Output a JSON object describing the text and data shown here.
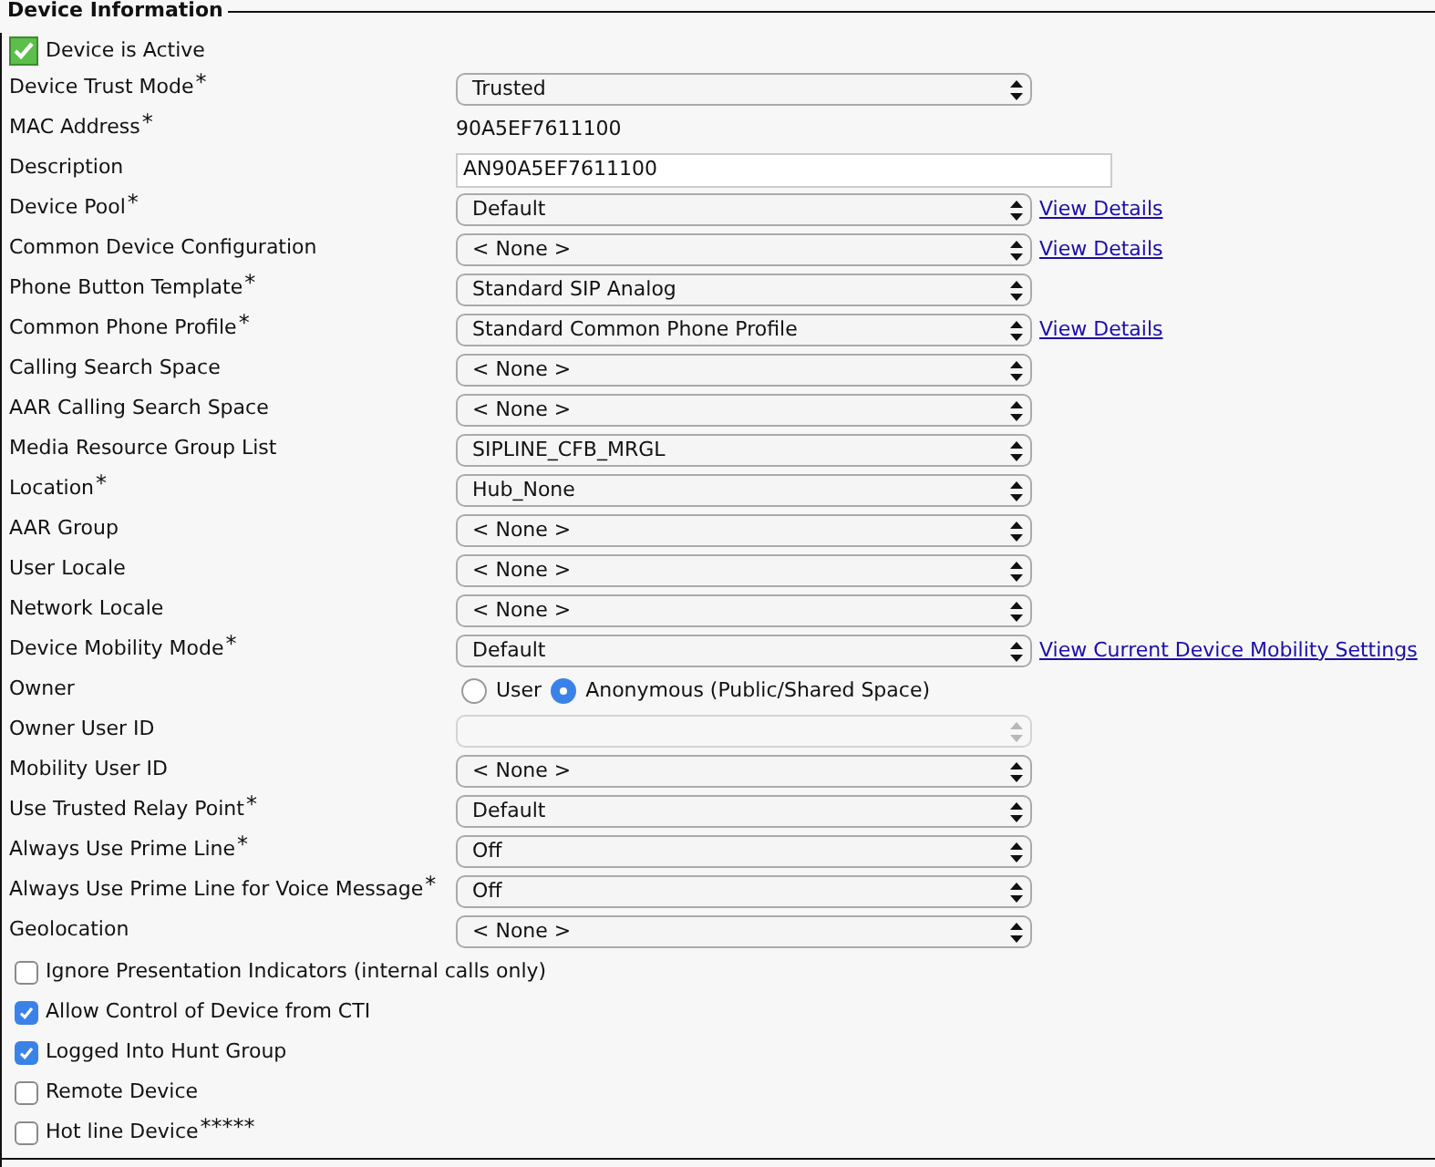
{
  "section": {
    "title": "Device Information"
  },
  "device_active": {
    "label": "Device is Active",
    "checked": true
  },
  "fields": [
    {
      "label": "Device Trust Mode",
      "mark": "*",
      "kind": "select",
      "value": "Trusted",
      "disabled": false
    },
    {
      "label": "MAC Address",
      "mark": "*",
      "kind": "text",
      "value": "90A5EF7611100"
    },
    {
      "label": "Description",
      "kind": "input",
      "value": "AN90A5EF7611100"
    },
    {
      "label": "Device Pool",
      "mark": "*",
      "kind": "select",
      "value": "Default",
      "disabled": false,
      "link": "View Details"
    },
    {
      "label": "Common Device Configuration",
      "kind": "select",
      "value": "< None >",
      "disabled": false,
      "link": "View Details"
    },
    {
      "label": "Phone Button Template",
      "mark": "*",
      "kind": "select",
      "value": "Standard SIP Analog",
      "disabled": false
    },
    {
      "label": "Common Phone Profile",
      "mark": "*",
      "kind": "select",
      "value": "Standard Common Phone Profile",
      "disabled": false,
      "link": "View Details"
    },
    {
      "label": "Calling Search Space",
      "kind": "select",
      "value": "< None >",
      "disabled": false
    },
    {
      "label": "AAR Calling Search Space",
      "kind": "select",
      "value": "< None >",
      "disabled": false
    },
    {
      "label": "Media Resource Group List",
      "kind": "select",
      "value": "SIPLINE_CFB_MRGL",
      "disabled": false
    },
    {
      "label": "Location",
      "mark": "*",
      "kind": "select",
      "value": "Hub_None",
      "disabled": false
    },
    {
      "label": "AAR Group",
      "kind": "select",
      "value": "< None >",
      "disabled": false
    },
    {
      "label": "User Locale",
      "kind": "select",
      "value": "< None >",
      "disabled": false
    },
    {
      "label": "Network Locale",
      "kind": "select",
      "value": "< None >",
      "disabled": false
    },
    {
      "label": "Device Mobility Mode",
      "mark": "*",
      "kind": "select",
      "value": "Default",
      "disabled": false,
      "link": "View Current Device Mobility Settings"
    },
    {
      "label": "Owner",
      "kind": "radio",
      "options": [
        {
          "label": "User",
          "selected": false
        },
        {
          "label": "Anonymous (Public/Shared Space)",
          "selected": true
        }
      ]
    },
    {
      "label": "Owner User ID",
      "kind": "select",
      "disabled": true
    },
    {
      "label": "Mobility User ID",
      "kind": "select",
      "value": "< None >",
      "disabled": false
    },
    {
      "label": "Use Trusted Relay Point",
      "mark": "*",
      "kind": "select",
      "value": "Default",
      "disabled": false
    },
    {
      "label": "Always Use Prime Line",
      "mark": "*",
      "kind": "select",
      "value": "Off",
      "disabled": false
    },
    {
      "label": "Always Use Prime Line for Voice Message",
      "mark": "*",
      "kind": "select",
      "value": "Off",
      "disabled": false
    },
    {
      "label": "Geolocation",
      "kind": "select",
      "value": "< None >",
      "disabled": false
    }
  ],
  "checkboxes": [
    {
      "label": "Ignore Presentation Indicators (internal calls only)",
      "checked": false
    },
    {
      "label": "Allow Control of Device from CTI",
      "checked": true
    },
    {
      "label": "Logged Into Hunt Group",
      "checked": true
    },
    {
      "label": "Remote Device",
      "checked": false
    },
    {
      "label": "Hot line Device",
      "mark": "*****",
      "checked": false
    }
  ]
}
